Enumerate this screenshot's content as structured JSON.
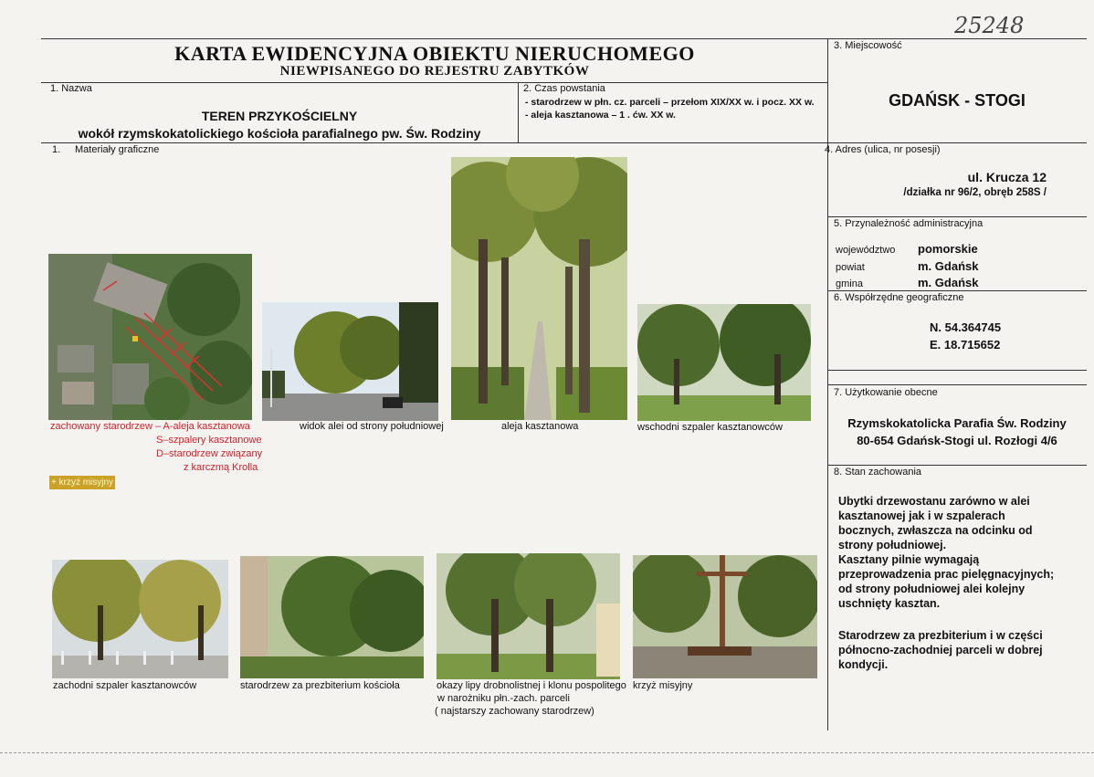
{
  "inventory_number": "25248",
  "header": {
    "title": "KARTA EWIDENCYJNA OBIEKTU NIERUCHOMEGO",
    "subtitle": "NIEWPISANEGO DO REJESTRU ZABYTKÓW"
  },
  "section1": {
    "label": "1. Nazwa",
    "name_line1": "TEREN PRZYKOŚCIELNY",
    "name_line2": "wokół rzymskokatolickiego kościoła parafialnego pw. Św. Rodziny"
  },
  "section2": {
    "label": "2. Czas powstania",
    "line1": "- starodrzew w płn. cz. parceli – przełom XIX/XX w. i pocz. XX w.",
    "line2": "- aleja kasztanowa – 1 . ćw. XX w."
  },
  "section3": {
    "label": "3. Miejscowość",
    "value": "GDAŃSK - STOGI"
  },
  "graphics": {
    "label_num": "1.",
    "label": "Materiały graficzne"
  },
  "section4": {
    "label": "4.  Adres (ulica, nr posesji)",
    "street": "ul. Krucza 12",
    "plot": "/działka nr 96/2, obręb 258S /"
  },
  "section5": {
    "label": "5. Przynależność administracyjna",
    "rows": [
      {
        "key": "województwo",
        "value": "pomorskie"
      },
      {
        "key": "powiat",
        "value": "m. Gdańsk"
      },
      {
        "key": "gmina",
        "value": "m. Gdańsk"
      }
    ]
  },
  "section6": {
    "label": "6. Współrzędne geograficzne",
    "lat": "N. 54.364745",
    "lon": "E. 18.715652"
  },
  "section7": {
    "label": "7. Użytkowanie obecne",
    "line1": "Rzymskokatolicka Parafia Św. Rodziny",
    "line2": "80-654 Gdańsk-Stogi ul. Rozłogi  4/6"
  },
  "section8": {
    "label": "8. Stan zachowania",
    "para1": "Ubytki drzewostanu zarówno w alei kasztanowej jak i w szpalerach bocznych, zwłaszcza na odcinku od strony południowej.",
    "para2": "Kasztany pilnie wymagają przeprowadzenia prac pielęgnacyjnych; od strony południowej alei kolejny uschnięty kasztan.",
    "para3": "Starodrzew za prezbiterium i w części północno-zachodniej parceli w dobrej kondycji."
  },
  "legend": {
    "line1": "zachowany starodrzew – A-aleja kasztanowa",
    "line2": "S–szpalery kasztanowe",
    "line3": "D–starodrzew związany",
    "line4": "z karczmą Krolla",
    "cross": "+  krzyż misyjny"
  },
  "captions": {
    "p1": "widok alei od strony południowej",
    "p2": "aleja kasztanowa",
    "p3": "wschodni szpaler kasztanowców",
    "p4": "zachodni szpaler kasztanowców",
    "p5": "starodrzew za prezbiterium kościoła",
    "p6_line1": "okazy lipy drobnolistnej i klonu pospolitego",
    "p6_line2": "w narożniku płn.-zach. parceli",
    "p6_line3": "( najstarszy zachowany starodrzew)",
    "p7": "krzyż misyjny"
  },
  "colors": {
    "legend_red": "#d6202a",
    "cross_tag_bg": "#c9a227",
    "paper": "#f4f3f0"
  }
}
